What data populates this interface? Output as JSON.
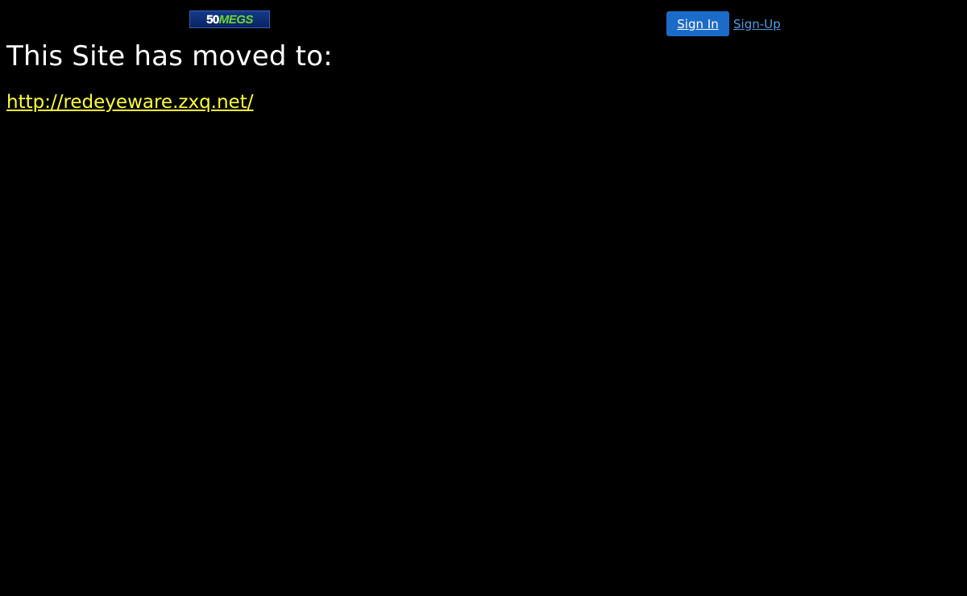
{
  "header": {
    "logo": {
      "number": "50",
      "word": "MEGS",
      "icon": "fiftymegs-logo"
    },
    "auth": {
      "signin_label": "Sign In",
      "signup_label": "Sign-Up"
    }
  },
  "main": {
    "heading": "This Site has moved to:",
    "link_text": "http://redeyeware.zxq.net/"
  },
  "colors": {
    "background": "#000000",
    "heading": "#ffffff",
    "link": "#ffff33",
    "signin_bg": "#1b6bc9",
    "signup_link": "#4d9ee8",
    "logo_bg": "#123a8a",
    "logo_accent": "#6fd62c"
  }
}
